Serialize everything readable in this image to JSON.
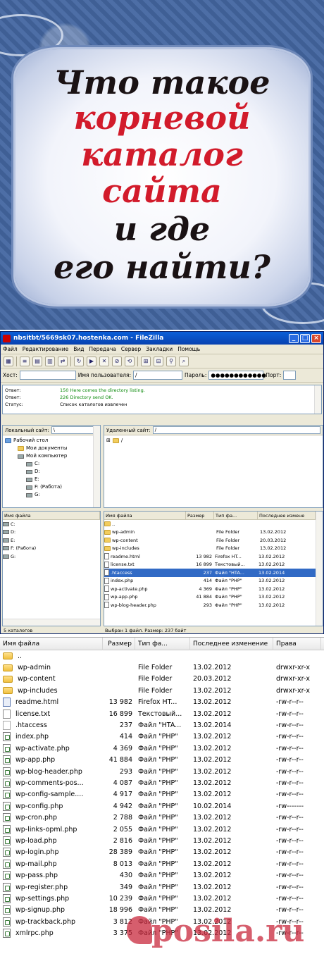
{
  "banner": {
    "line1": "Что такое",
    "line2": "корневой",
    "line3": "каталог",
    "line4": "сайта",
    "line5": "и где",
    "line6": "его найти?"
  },
  "window": {
    "title": "nbsitbt/5669sk07.hostenka.com - FileZilla",
    "menu": [
      "Файл",
      "Редактирование",
      "Вид",
      "Передача",
      "Сервер",
      "Закладки",
      "Помощь"
    ],
    "quick": {
      "host_label": "Хост:",
      "user_label": "Имя пользователя:",
      "user_value": "/",
      "pass_label": "Пароль:",
      "pass_value": "●●●●●●●●●●●●",
      "port_label": "Порт:"
    },
    "log": [
      {
        "label": "Ответ:",
        "text": "150 Here comes the directory listing."
      },
      {
        "label": "Ответ:",
        "text": "226 Directory send OK."
      },
      {
        "label": "Статус:",
        "text": "Список каталогов извлечен"
      }
    ],
    "local_site_label": "Локальный сайт:",
    "local_site_value": "\\",
    "remote_site_label": "Удаленный сайт:",
    "remote_site_value": "/",
    "local_tree": [
      "Рабочий стол",
      "Мои документы",
      "Мой компьютер",
      "C:",
      "D:",
      "E:",
      "F: (Работа)",
      "G:"
    ],
    "remote_tree": [
      "/"
    ],
    "local_cols": [
      "Имя файла"
    ],
    "local_files": [
      "C:",
      "D:",
      "E:",
      "F: (Работа)",
      "G:"
    ],
    "local_status": "5 каталогов",
    "remote_cols": [
      "Имя файла",
      "Размер",
      "Тип фа...",
      "Последнее измене"
    ],
    "remote_status": "Выбран 1 файл. Размер: 237 байт"
  },
  "files": {
    "columns": [
      "Имя файла",
      "Размер",
      "Тип фа...",
      "Последнее изменение",
      "Права"
    ],
    "rows": [
      {
        "name": "..",
        "size": "",
        "type": "",
        "date": "",
        "perm": "",
        "icon": "folder"
      },
      {
        "name": "wp-admin",
        "size": "",
        "type": "File Folder",
        "date": "13.02.2012",
        "perm": "drwxr-xr-x",
        "icon": "folder"
      },
      {
        "name": "wp-content",
        "size": "",
        "type": "File Folder",
        "date": "20.03.2012",
        "perm": "drwxr-xr-x",
        "icon": "folder"
      },
      {
        "name": "wp-includes",
        "size": "",
        "type": "File Folder",
        "date": "13.02.2012",
        "perm": "drwxr-xr-x",
        "icon": "folder"
      },
      {
        "name": "readme.html",
        "size": "13 982",
        "type": "Firefox HT...",
        "date": "13.02.2012",
        "perm": "-rw-r--r--",
        "icon": "html"
      },
      {
        "name": "license.txt",
        "size": "16 899",
        "type": "Текстовый...",
        "date": "13.02.2012",
        "perm": "-rw-r--r--",
        "icon": "txt"
      },
      {
        "name": ".htaccess",
        "size": "237",
        "type": "Файл \"HTA...",
        "date": "13.02.2014",
        "perm": "-rw-r--r--",
        "icon": "ht"
      },
      {
        "name": "index.php",
        "size": "414",
        "type": "Файл \"PHP\"",
        "date": "13.02.2012",
        "perm": "-rw-r--r--",
        "icon": "php"
      },
      {
        "name": "wp-activate.php",
        "size": "4 369",
        "type": "Файл \"PHP\"",
        "date": "13.02.2012",
        "perm": "-rw-r--r--",
        "icon": "php"
      },
      {
        "name": "wp-app.php",
        "size": "41 884",
        "type": "Файл \"PHP\"",
        "date": "13.02.2012",
        "perm": "-rw-r--r--",
        "icon": "php"
      },
      {
        "name": "wp-blog-header.php",
        "size": "293",
        "type": "Файл \"PHP\"",
        "date": "13.02.2012",
        "perm": "-rw-r--r--",
        "icon": "php"
      },
      {
        "name": "wp-comments-pos...",
        "size": "4 087",
        "type": "Файл \"PHP\"",
        "date": "13.02.2012",
        "perm": "-rw-r--r--",
        "icon": "php"
      },
      {
        "name": "wp-config-sample....",
        "size": "4 917",
        "type": "Файл \"PHP\"",
        "date": "13.02.2012",
        "perm": "-rw-r--r--",
        "icon": "php"
      },
      {
        "name": "wp-config.php",
        "size": "4 942",
        "type": "Файл \"PHP\"",
        "date": "10.02.2014",
        "perm": "-rw-------",
        "icon": "php"
      },
      {
        "name": "wp-cron.php",
        "size": "2 788",
        "type": "Файл \"PHP\"",
        "date": "13.02.2012",
        "perm": "-rw-r--r--",
        "icon": "php"
      },
      {
        "name": "wp-links-opml.php",
        "size": "2 055",
        "type": "Файл \"PHP\"",
        "date": "13.02.2012",
        "perm": "-rw-r--r--",
        "icon": "php"
      },
      {
        "name": "wp-load.php",
        "size": "2 816",
        "type": "Файл \"PHP\"",
        "date": "13.02.2012",
        "perm": "-rw-r--r--",
        "icon": "php"
      },
      {
        "name": "wp-login.php",
        "size": "28 389",
        "type": "Файл \"PHP\"",
        "date": "13.02.2012",
        "perm": "-rw-r--r--",
        "icon": "php"
      },
      {
        "name": "wp-mail.php",
        "size": "8 013",
        "type": "Файл \"PHP\"",
        "date": "13.02.2012",
        "perm": "-rw-r--r--",
        "icon": "php"
      },
      {
        "name": "wp-pass.php",
        "size": "430",
        "type": "Файл \"PHP\"",
        "date": "13.02.2012",
        "perm": "-rw-r--r--",
        "icon": "php"
      },
      {
        "name": "wp-register.php",
        "size": "349",
        "type": "Файл \"PHP\"",
        "date": "13.02.2012",
        "perm": "-rw-r--r--",
        "icon": "php"
      },
      {
        "name": "wp-settings.php",
        "size": "10 239",
        "type": "Файл \"PHP\"",
        "date": "13.02.2012",
        "perm": "-rw-r--r--",
        "icon": "php"
      },
      {
        "name": "wp-signup.php",
        "size": "18 996",
        "type": "Файл \"PHP\"",
        "date": "13.02.2012",
        "perm": "-rw-r--r--",
        "icon": "php"
      },
      {
        "name": "wp-trackback.php",
        "size": "3 812",
        "type": "Файл \"PHP\"",
        "date": "13.02.2012",
        "perm": "-rw-r--r--",
        "icon": "php"
      },
      {
        "name": "xmlrpc.php",
        "size": "3 375",
        "type": "Файл \"PHP\"",
        "date": "13.02.2012",
        "perm": "-rw-r--r--",
        "icon": "php"
      }
    ]
  },
  "watermark": "posila.ru",
  "colors": {
    "accent": "#316ac5",
    "banner_red": "#d21b2b",
    "banner_bg": "#45659c"
  }
}
